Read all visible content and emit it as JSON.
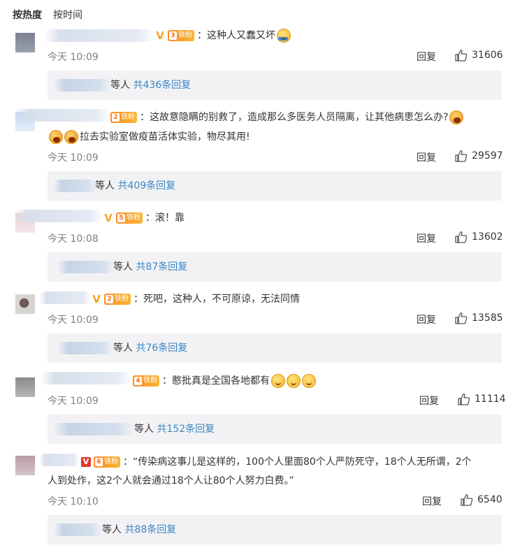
{
  "tabs": {
    "hot": "按热度",
    "time": "按时间"
  },
  "comments": [
    {
      "text": "：这种人又蠢又坏",
      "text_line2": "",
      "fan_label": "铁粉",
      "fan_level": "3",
      "badge": "V",
      "time": "今天 10:09",
      "reply": "回复",
      "likes": "31606",
      "sub_suffix": "等人",
      "sub_count": "共436条回复"
    },
    {
      "text": "：这故意隐瞒的别救了，造成那么多医务人员隔离，让其他病患怎么办?",
      "text_line2": "拉去实验室做疫苗活体实验，物尽其用!",
      "fan_label": "铁粉",
      "fan_level": "2",
      "badge": "",
      "time": "今天 10:09",
      "reply": "回复",
      "likes": "29597",
      "sub_suffix": "等人",
      "sub_count": "共409条回复"
    },
    {
      "text": "：滚！靠",
      "text_line2": "",
      "fan_label": "铁粉",
      "fan_level": "5",
      "badge": "V",
      "time": "今天 10:08",
      "reply": "回复",
      "likes": "13602",
      "sub_suffix": "等人",
      "sub_count": "共87条回复"
    },
    {
      "text": "：死吧，这种人，不可原谅，无法同情",
      "text_line2": "",
      "fan_label": "铁粉",
      "fan_level": "2",
      "badge": "V",
      "time": "今天 10:09",
      "reply": "回复",
      "likes": "13585",
      "sub_suffix": "等人",
      "sub_count": "共76条回复"
    },
    {
      "text": "：憨批真是全国各地都有",
      "text_line2": "",
      "fan_label": "铁粉",
      "fan_level": "4",
      "badge": "",
      "time": "今天 10:09",
      "reply": "回复",
      "likes": "11114",
      "sub_suffix": "等人",
      "sub_count": "共152条回复"
    },
    {
      "text": "：“传染病这事儿是这样的，100个人里面80个人严防死守，18个人无所谓，2个",
      "text_line2": "人到处作，这2个人就会通过18个人让80个人努力白费。”",
      "fan_label": "铁粉",
      "fan_level": "6",
      "badge": "V",
      "time": "今天 10:10",
      "reply": "回复",
      "likes": "6540",
      "sub_suffix": "等人",
      "sub_count": "共88条回复"
    }
  ],
  "colors": {
    "link": "#3b86c4",
    "meta": "#808080",
    "sub_bg": "#f2f2f5",
    "fan_badge": "#f7a02a"
  }
}
